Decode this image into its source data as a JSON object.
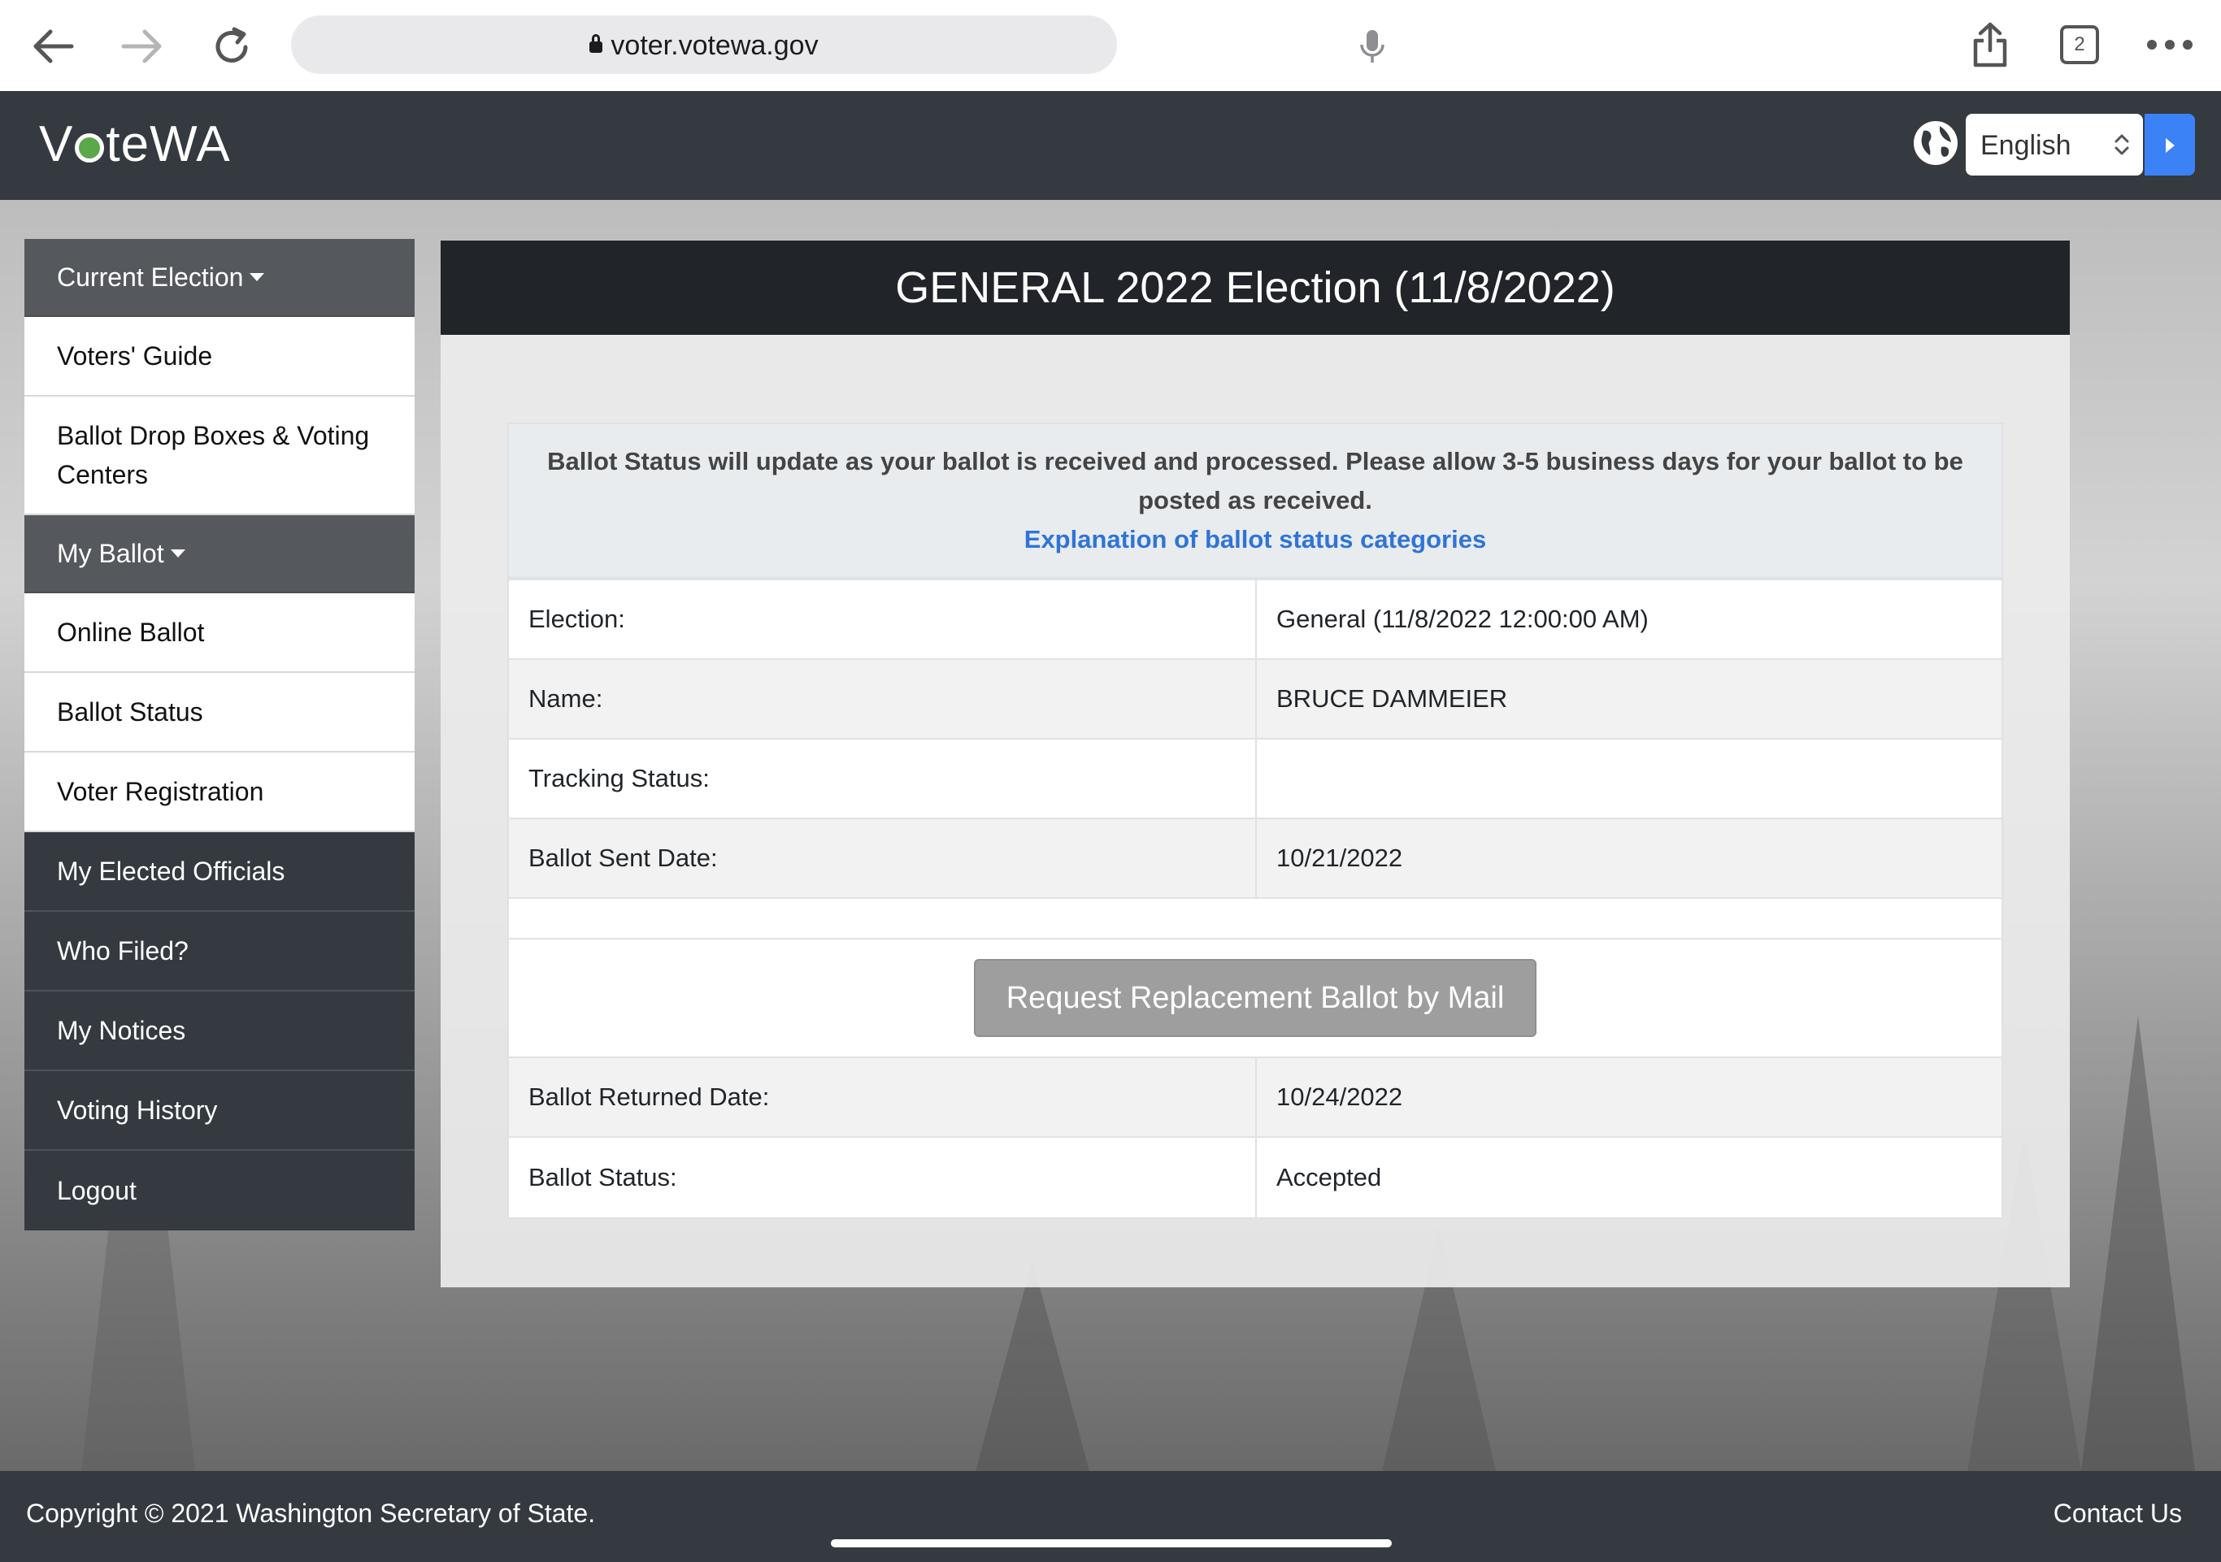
{
  "browser": {
    "url": "voter.votewa.gov",
    "tab_count": "2"
  },
  "header": {
    "logo_text_1": "V",
    "logo_text_2": "teWA",
    "language": "English"
  },
  "sidebar": {
    "items": [
      {
        "label": "Current Election",
        "style": "header",
        "caret": true
      },
      {
        "label": "Voters' Guide",
        "style": "light"
      },
      {
        "label": "Ballot Drop Boxes & Voting Centers",
        "style": "light"
      },
      {
        "label": "My Ballot",
        "style": "header",
        "caret": true
      },
      {
        "label": "Online Ballot",
        "style": "light"
      },
      {
        "label": "Ballot Status",
        "style": "light"
      },
      {
        "label": "Voter Registration",
        "style": "light"
      },
      {
        "label": "My Elected Officials",
        "style": "dark"
      },
      {
        "label": "Who Filed?",
        "style": "dark"
      },
      {
        "label": "My Notices",
        "style": "dark"
      },
      {
        "label": "Voting History",
        "style": "dark"
      },
      {
        "label": "Logout",
        "style": "dark"
      }
    ]
  },
  "main": {
    "title": "GENERAL 2022 Election (11/8/2022)",
    "notice_text": "Ballot Status will update as your ballot is received and processed. Please allow 3-5 business days for your ballot to be posted as received.",
    "notice_link": "Explanation of ballot status categories",
    "rows_top": [
      {
        "label": "Election:",
        "value": "General (11/8/2022 12:00:00 AM)"
      },
      {
        "label": "Name:",
        "value": "BRUCE DAMMEIER"
      },
      {
        "label": "Tracking Status:",
        "value": ""
      },
      {
        "label": "Ballot Sent Date:",
        "value": "10/21/2022"
      }
    ],
    "replace_button": "Request Replacement Ballot by Mail",
    "rows_bottom": [
      {
        "label": "Ballot Returned Date:",
        "value": "10/24/2022"
      },
      {
        "label": "Ballot Status:",
        "value": "Accepted"
      }
    ]
  },
  "footer": {
    "copyright": "Copyright © 2021 Washington Secretary of State.",
    "contact": "Contact Us"
  },
  "colors": {
    "header_bg": "#343a40",
    "accent_blue": "#3b82f6",
    "link_blue": "#2f74d8",
    "logo_green": "#5aa84a"
  }
}
